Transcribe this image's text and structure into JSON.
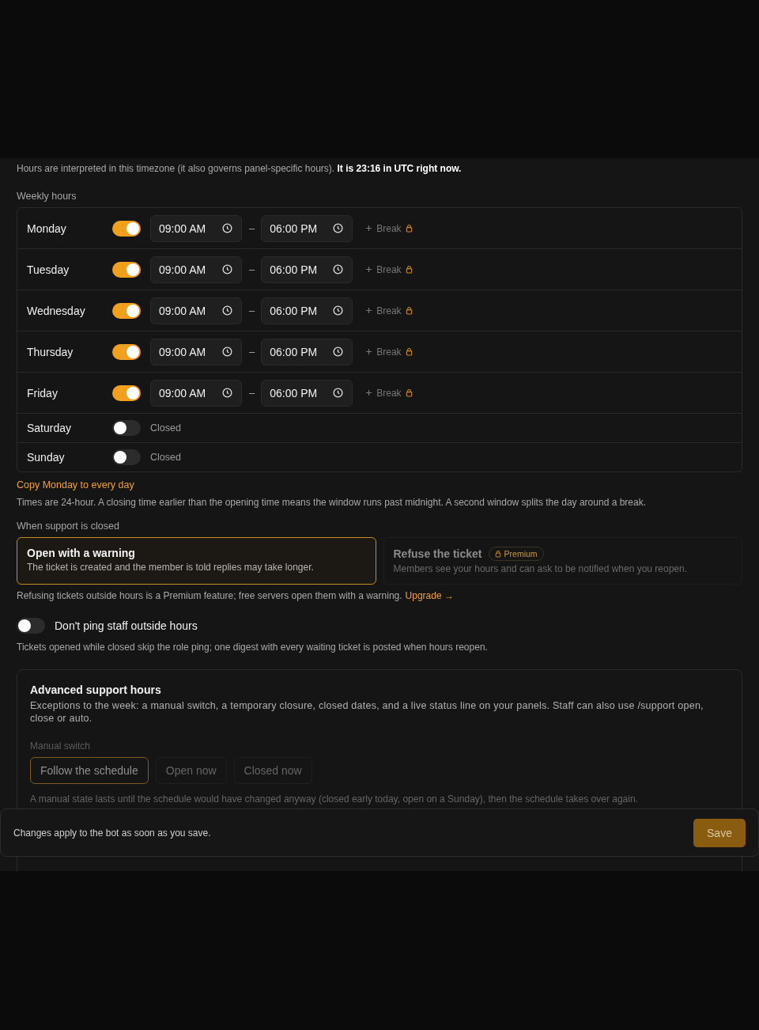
{
  "timezone_note": "Hours are interpreted in this timezone (it also governs panel-specific hours). **It is 23:16 in UTC right now.**",
  "weekly_hours": {
    "label": "Weekly hours",
    "separator": "–",
    "days": [
      {
        "name": "Monday",
        "on": true,
        "open": "09:00 AM",
        "close": "06:00 PM",
        "break_label": "Break"
      },
      {
        "name": "Tuesday",
        "on": true,
        "open": "09:00 AM",
        "close": "06:00 PM",
        "break_label": "Break"
      },
      {
        "name": "Wednesday",
        "on": true,
        "open": "09:00 AM",
        "close": "06:00 PM",
        "break_label": "Break"
      },
      {
        "name": "Thursday",
        "on": true,
        "open": "09:00 AM",
        "close": "06:00 PM",
        "break_label": "Break"
      },
      {
        "name": "Friday",
        "on": true,
        "open": "09:00 AM",
        "close": "06:00 PM",
        "break_label": "Break"
      },
      {
        "name": "Saturday",
        "on": false,
        "closed_label": "Closed"
      },
      {
        "name": "Sunday",
        "on": false,
        "closed_label": "Closed"
      }
    ]
  },
  "copy_link": "Copy Monday to every day",
  "times_note": "Times are 24-hour. A closing time earlier than the opening time means the window runs past midnight. A second window splits the day around a break.",
  "closed_behavior": {
    "label": "When support is closed",
    "options": [
      {
        "title": "Open with a warning",
        "description": "The ticket is created and the member is told replies may take longer.",
        "selected": true,
        "locked": false
      },
      {
        "title": "Refuse the ticket",
        "badge": "Premium",
        "description": "Members see your hours and can ask to be notified when you reopen.",
        "selected": false,
        "locked": true
      }
    ],
    "note": "Refusing tickets outside hours is a Premium feature; free servers open them with a warning.",
    "upgrade_link": "Upgrade →"
  },
  "ping_toggle": {
    "label": "Don't ping staff outside hours",
    "on": false,
    "description": "Tickets opened while closed skip the role ping; one digest with every waiting ticket is posted when hours reopen."
  },
  "advanced": {
    "title": "Advanced support hours",
    "description": "Exceptions to the week: a manual switch, a temporary closure, closed dates, and a live status line on your panels. Staff can also use /support open, close or auto.",
    "disabled": true,
    "manual_switch": {
      "label": "Manual switch",
      "options": [
        {
          "label": "Follow the schedule",
          "selected": true
        },
        {
          "label": "Open now",
          "selected": false
        },
        {
          "label": "Closed now",
          "selected": false
        }
      ],
      "note": "A manual state lasts until the schedule would have changed anyway (closed early today, open on a Sunday), then the schedule takes over again."
    }
  },
  "save_bar": {
    "text": "Changes apply to the bot as soon as you save.",
    "button": "Save"
  }
}
